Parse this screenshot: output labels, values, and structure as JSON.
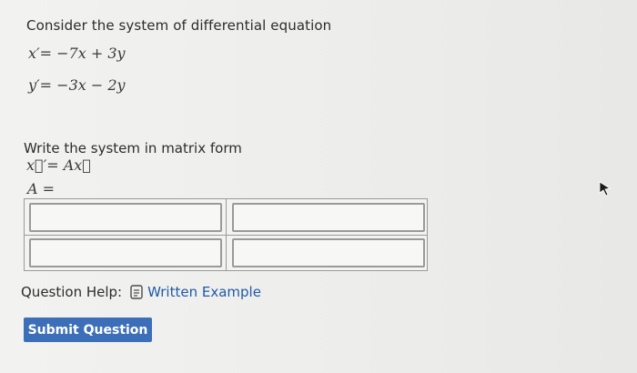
{
  "question": {
    "intro": "Consider the system of differential equation",
    "equations": [
      "x′= −7x + 3y",
      "y′= −3x − 2y"
    ],
    "prompt": "Write the system in matrix form",
    "matrix_equation": "x⃗′= Ax⃗",
    "a_label": "A ="
  },
  "matrix": {
    "cells": [
      {
        "value": ""
      },
      {
        "value": ""
      },
      {
        "value": ""
      },
      {
        "value": ""
      }
    ]
  },
  "help": {
    "label": "Question Help:",
    "link_text": "Written Example",
    "icon": "document-icon"
  },
  "submit": {
    "label": "Submit Question"
  },
  "colors": {
    "accent": "#3c6fb8",
    "link": "#1f5aa6",
    "background": "#eeeeec"
  }
}
